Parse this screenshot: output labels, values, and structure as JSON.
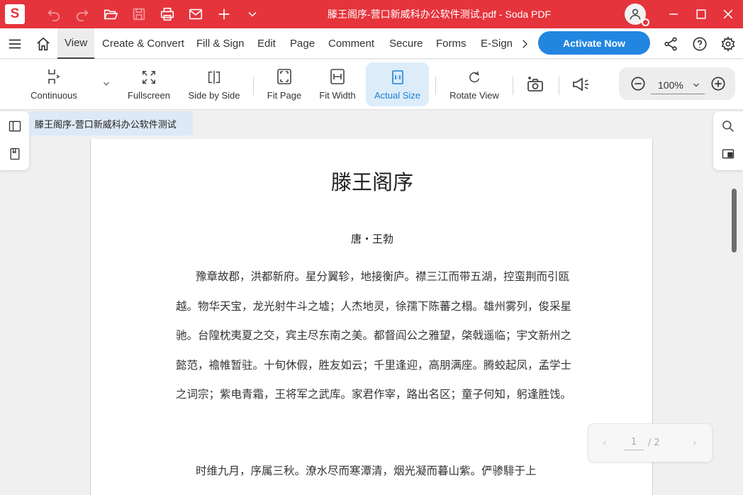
{
  "app": {
    "logo_letter": "S",
    "window_title": "滕王阁序-营口新威科办公软件测试.pdf  -  Soda PDF"
  },
  "titlebar": {
    "icons": [
      "undo-icon",
      "redo-icon",
      "open-folder-icon",
      "save-icon",
      "print-icon",
      "mail-icon",
      "plus-icon",
      "chevron-down-icon",
      "user-avatar-icon",
      "minimize-icon",
      "maximize-icon",
      "close-icon"
    ]
  },
  "menu": {
    "items": [
      "View",
      "Create & Convert",
      "Fill & Sign",
      "Edit",
      "Page",
      "Comment",
      "Secure",
      "Forms",
      "E-Sign"
    ],
    "active": "View",
    "activate_label": "Activate Now",
    "accent_color": "#2286e0"
  },
  "toolbar": {
    "tools": [
      {
        "label": "Continuous",
        "icon": "continuous-icon"
      },
      {
        "label": "Fullscreen",
        "icon": "fullscreen-icon"
      },
      {
        "label": "Side by Side",
        "icon": "side-by-side-icon"
      },
      {
        "label": "Fit Page",
        "icon": "fit-page-icon"
      },
      {
        "label": "Fit Width",
        "icon": "fit-width-icon"
      },
      {
        "label": "Actual Size",
        "icon": "actual-size-icon",
        "active": true
      },
      {
        "label": "Rotate View",
        "icon": "rotate-icon"
      }
    ],
    "zoom_value": "100%"
  },
  "doc_tab": {
    "label": "滕王阁序-营口新威科办公软件测试"
  },
  "document": {
    "title": "滕王阁序",
    "author": "唐・王勃",
    "para1": "豫章故郡，洪都新府。星分翼轸，地接衡庐。襟三江而带五湖，控蛮荆而引瓯越。物华天宝，龙光射牛斗之墟；人杰地灵，徐孺下陈蕃之榻。雄州雾列，俊采星驰。台隍枕夷夏之交，宾主尽东南之美。都督阎公之雅望，棨戟遥临；宇文新州之懿范，襜帷暂驻。十旬休假，胜友如云；千里逢迎，高朋满座。腾蛟起凤，孟学士之词宗；紫电青霜，王将军之武库。家君作宰，路出名区；童子何知，躬逢胜饯。",
    "para2": "时维九月，序属三秋。潦水尽而寒潭清，烟光凝而暮山紫。俨骖騑于上"
  },
  "pager": {
    "current": "1",
    "total": "/ 2"
  },
  "colors": {
    "brand_red": "#e5343c",
    "active_tool_bg": "#dcecf9"
  }
}
